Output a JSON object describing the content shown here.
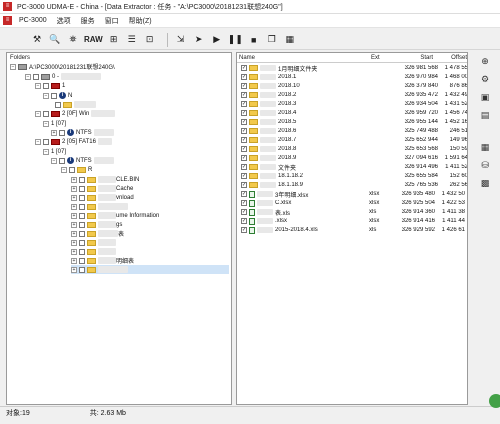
{
  "titlebar": {
    "title": "PC-3000 UDMA-E - China - [Data Extractor : 任务 - \"A:\\PC3000\\20181231联想240G\"]"
  },
  "menubar": {
    "items": [
      "PC-3000",
      "选项",
      "服务",
      "窗口",
      "帮助(Z)"
    ]
  },
  "toolbar": {
    "raw_label": "RAW"
  },
  "folders_pane": {
    "title": "Folders",
    "rows": [
      "A:\\PC3000\\20181231联想240G\\",
      "0 - ",
      "1",
      "N",
      "2 [0F] Win",
      "1 [07]",
      "NTFS",
      "2 [05] FAT16",
      "1 [07]",
      "NTFS",
      "R",
      "CLE.BIN",
      "Cache",
      "vnload",
      "ume Information",
      "gs",
      "表",
      "明细表"
    ]
  },
  "files_pane": {
    "columns": [
      "Name",
      "Ext",
      "Start",
      "Offset"
    ],
    "rows": [
      {
        "name": "1月明细文件夹",
        "ext": "",
        "start": "326 981 568",
        "offset": "1 478 55"
      },
      {
        "name": "2018.1",
        "ext": "",
        "start": "326 970 984",
        "offset": "1 468 00"
      },
      {
        "name": "2018.10",
        "ext": "",
        "start": "326 379 840",
        "offset": "876 86"
      },
      {
        "name": "2018.2",
        "ext": "",
        "start": "326 935 472",
        "offset": "1 432 49"
      },
      {
        "name": "2018.3",
        "ext": "",
        "start": "326 934 504",
        "offset": "1 431 52"
      },
      {
        "name": "2018.4",
        "ext": "",
        "start": "326 959 720",
        "offset": "1 456 74"
      },
      {
        "name": "2018.5",
        "ext": "",
        "start": "326 955 144",
        "offset": "1 452 16"
      },
      {
        "name": "2018.6",
        "ext": "",
        "start": "325 749 488",
        "offset": "246 51"
      },
      {
        "name": "2018.7",
        "ext": "",
        "start": "325 652 944",
        "offset": "149 96"
      },
      {
        "name": "2018.8",
        "ext": "",
        "start": "325 653 568",
        "offset": "150 59"
      },
      {
        "name": "2018.9",
        "ext": "",
        "start": "327 094 616",
        "offset": "1 591 64"
      },
      {
        "name": "文件夹",
        "ext": "",
        "start": "326 914 496",
        "offset": "1 411 52"
      },
      {
        "name": "18.1.18.2",
        "ext": "",
        "start": "325 655 584",
        "offset": "152 60"
      },
      {
        "name": "18.1.18.9",
        "ext": "",
        "start": "325 765 536",
        "offset": "262 56"
      },
      {
        "name": "3年明细.xlsx",
        "ext": "xlsx",
        "start": "326 935 480",
        "offset": "1 432 50"
      },
      {
        "name": "C.xlsx",
        "ext": "xlsx",
        "start": "326 925 504",
        "offset": "1 422 53"
      },
      {
        "name": "表.xls",
        "ext": "xls",
        "start": "326 914 360",
        "offset": "1 411 38"
      },
      {
        "name": ".xlsx",
        "ext": "xlsx",
        "start": "326 914 416",
        "offset": "1 411 44"
      },
      {
        "name": "2015-2018.4.xls",
        "ext": "xls",
        "start": "326 929 592",
        "offset": "1 426 61"
      }
    ]
  },
  "statusbar": {
    "objects": "对象:19",
    "size": "共: 2.63 Mb"
  }
}
